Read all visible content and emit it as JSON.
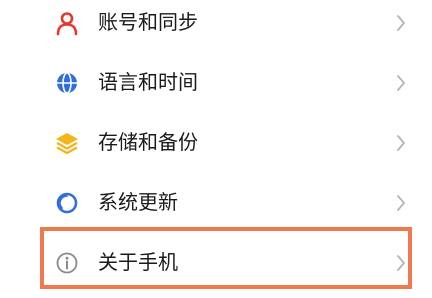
{
  "settings": {
    "items": [
      {
        "label": "账号和同步",
        "icon": "person-icon",
        "color": "#e5392f"
      },
      {
        "label": "语言和时间",
        "icon": "globe-icon",
        "color": "#2f6de0"
      },
      {
        "label": "存储和备份",
        "icon": "layers-icon",
        "color": "#f4b41a"
      },
      {
        "label": "系统更新",
        "icon": "update-circle-icon",
        "color": "#2f6de0"
      },
      {
        "label": "关于手机",
        "icon": "info-icon",
        "color": "#8a8a8a"
      }
    ]
  },
  "colors": {
    "highlight_border": "#ef7a4f",
    "chevron": "#b5b5b5",
    "text": "#1b1b1b"
  }
}
